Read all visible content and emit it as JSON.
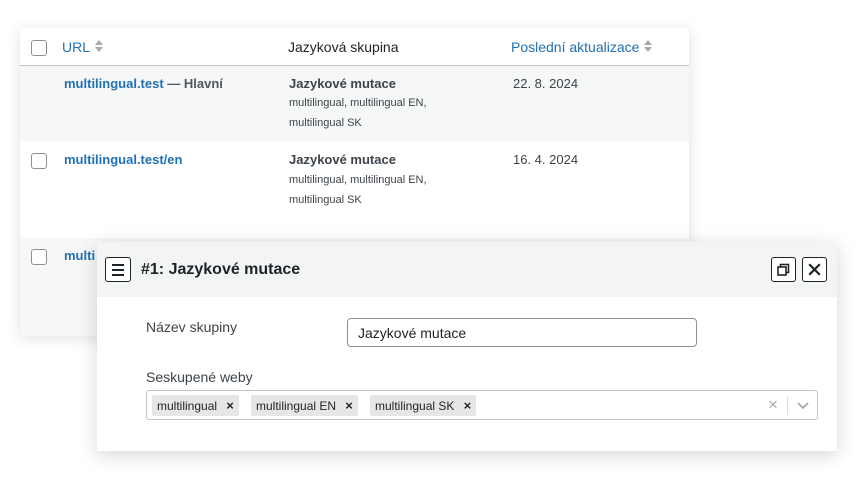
{
  "table": {
    "headers": {
      "url": "URL",
      "group": "Jazyková skupina",
      "updated": "Poslední aktualizace"
    },
    "rows": [
      {
        "url": "multilingual.test",
        "suffix": " — Hlavní",
        "group": "Jazykové mutace",
        "sites_line1": "multilingual, multilingual EN,",
        "sites_line2": "multilingual SK",
        "date": "22. 8. 2024"
      },
      {
        "url": "multilingual.test/en",
        "suffix": "",
        "group": "Jazykové mutace",
        "sites_line1": "multilingual, multilingual EN,",
        "sites_line2": "multilingual SK",
        "date": "16. 4. 2024"
      },
      {
        "url": "multi"
      }
    ]
  },
  "modal": {
    "title": "#1: Jazykové mutace",
    "name_label": "Název skupiny",
    "name_value": "Jazykové mutace",
    "sites_label": "Seskupené weby",
    "chips": [
      "multilingual",
      "multilingual EN",
      "multilingual SK"
    ],
    "remove_glyph": "×",
    "clear_glyph": "×"
  },
  "colors": {
    "link": "#2271b1",
    "row_alt": "#f6f7f7",
    "modal_header": "#f3f4f4"
  },
  "icons": [
    "sort-icon",
    "menu-icon",
    "popout-icon",
    "close-icon",
    "chevron-down-icon"
  ]
}
